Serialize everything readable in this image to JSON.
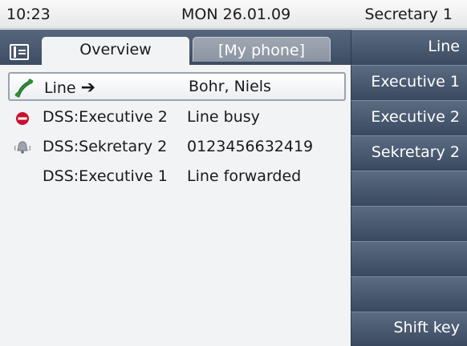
{
  "statusbar": {
    "time": "10:23",
    "date": "MON 26.01.09",
    "user": "Secretary 1"
  },
  "tabs": {
    "overview": "Overview",
    "my_phone": "[My phone]"
  },
  "rows": [
    {
      "name": "Line",
      "status": "Bohr, Niels",
      "icon": "handset-icon",
      "selected": true
    },
    {
      "name": "DSS:Executive 2",
      "status": "Line busy",
      "icon": "busy-icon",
      "selected": false
    },
    {
      "name": "DSS:Sekretary 2",
      "status": "0123456632419",
      "icon": "ringing-bell-icon",
      "selected": false
    },
    {
      "name": "DSS:Executive 1",
      "status": "Line forwarded",
      "icon": "",
      "selected": false
    }
  ],
  "softkeys": [
    "Line",
    "Executive 1",
    "Executive 2",
    "Sekretary 2",
    "",
    "",
    "",
    "",
    "",
    "Shift key"
  ],
  "colors": {
    "header_blue": "#3d4c62",
    "busy_red": "#c8102e",
    "handset_green": "#2e8b3a"
  }
}
